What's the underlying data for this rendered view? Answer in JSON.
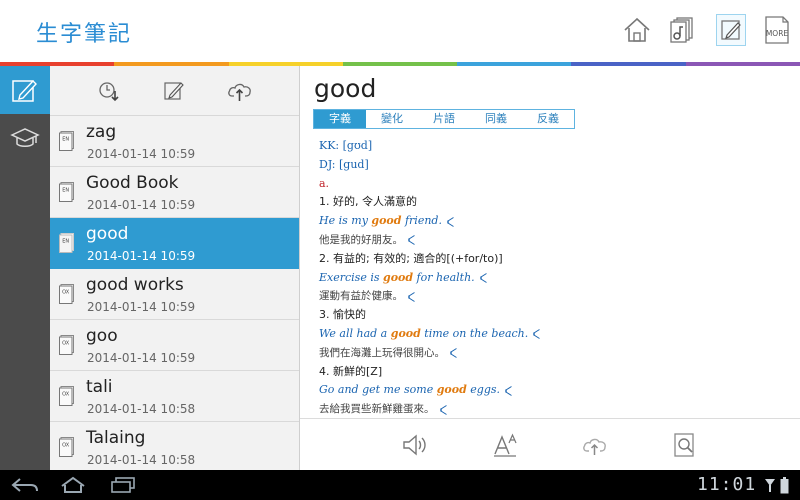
{
  "header": {
    "app_title": "生字筆記",
    "more_label": "MORE",
    "rainbow": [
      "#e8402e",
      "#f39a1f",
      "#f6d12a",
      "#74c14a",
      "#3ba3dc",
      "#4a63c6",
      "#8b57b5"
    ]
  },
  "rail": {
    "items": [
      {
        "icon": "notebook-edit-icon",
        "active": true
      },
      {
        "icon": "graduation-cap-icon",
        "active": false
      }
    ]
  },
  "list": {
    "toolbar": [
      "sort-by-time-icon",
      "edit-note-icon",
      "cloud-sync-icon"
    ],
    "words": [
      {
        "title": "zag",
        "date": "2014-01-14 10:59",
        "dict": "EN"
      },
      {
        "title": "Good Book",
        "date": "2014-01-14 10:59",
        "dict": "EN"
      },
      {
        "title": "good",
        "date": "2014-01-14 10:59",
        "dict": "EN",
        "selected": true
      },
      {
        "title": "good works",
        "date": "2014-01-14 10:59",
        "dict": "OX"
      },
      {
        "title": "goo",
        "date": "2014-01-14 10:59",
        "dict": "OX"
      },
      {
        "title": "tali",
        "date": "2014-01-14 10:58",
        "dict": "OX"
      },
      {
        "title": "Talaing",
        "date": "2014-01-14 10:58",
        "dict": "OX"
      }
    ]
  },
  "detail": {
    "headword": "good",
    "tabs": [
      "字義",
      "變化",
      "片語",
      "同義",
      "反義"
    ],
    "active_tab": 0,
    "kk": "KK: [gʊd]",
    "dj": "DJ: [gud]",
    "pos": "a.",
    "senses": [
      {
        "def": "1. 好的, 令人滿意的",
        "ex_pre": "He is my ",
        "ex_kw": "good",
        "ex_post": " friend.",
        "zh": "他是我的好朋友。"
      },
      {
        "def": "2. 有益的; 有效的; 適合的[(+for/to)]",
        "ex_pre": "Exercise is ",
        "ex_kw": "good",
        "ex_post": " for health.",
        "zh": "運動有益於健康。"
      },
      {
        "def": "3. 愉快的",
        "ex_pre": "We all had a ",
        "ex_kw": "good",
        "ex_post": " time on the beach.",
        "zh": "我們在海灘上玩得很開心。"
      },
      {
        "def": "4. 新鮮的[Z]",
        "ex_pre": "Go and get me some ",
        "ex_kw": "good",
        "ex_post": " eggs.",
        "zh": "去給我買些新鮮雞蛋來。"
      }
    ],
    "toolbar": [
      "speaker-icon",
      "font-size-icon",
      "cloud-upload-icon",
      "search-icon"
    ]
  },
  "system": {
    "time": "11:01"
  }
}
